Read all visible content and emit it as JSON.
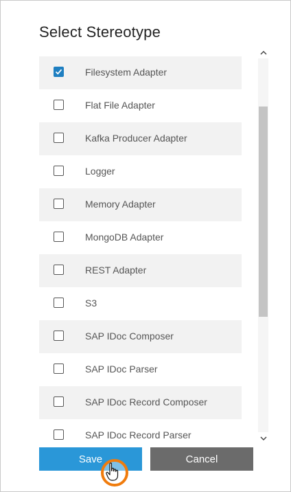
{
  "dialog": {
    "title": "Select Stereotype",
    "items": [
      {
        "label": "Filesystem Adapter",
        "checked": true
      },
      {
        "label": "Flat File Adapter",
        "checked": false
      },
      {
        "label": "Kafka Producer Adapter",
        "checked": false
      },
      {
        "label": "Logger",
        "checked": false
      },
      {
        "label": "Memory Adapter",
        "checked": false
      },
      {
        "label": "MongoDB Adapter",
        "checked": false
      },
      {
        "label": "REST Adapter",
        "checked": false
      },
      {
        "label": "S3",
        "checked": false
      },
      {
        "label": "SAP IDoc Composer",
        "checked": false
      },
      {
        "label": "SAP IDoc Parser",
        "checked": false
      },
      {
        "label": "SAP IDoc Record Composer",
        "checked": false
      },
      {
        "label": "SAP IDoc Record Parser",
        "checked": false
      }
    ],
    "save_label": "Save",
    "cancel_label": "Cancel"
  },
  "colors": {
    "accent": "#2a97d8",
    "checkbox_checked": "#1f7fc1",
    "cancel_button": "#6b6b6b",
    "cursor_highlight": "#f07c0d"
  },
  "icons": {
    "checkmark": "check-icon",
    "scroll_up": "chevron-up-icon",
    "scroll_down": "chevron-down-icon",
    "cursor": "hand-pointer-icon"
  }
}
